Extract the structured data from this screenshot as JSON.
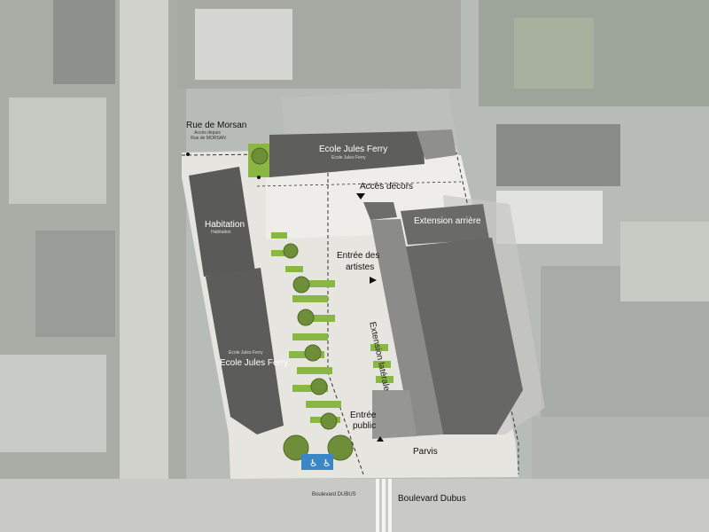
{
  "streets": {
    "rue_morsan": "Rue de Morsan",
    "acces_depuis": "Accès depuis",
    "rue_de_morsan_caps": "Rue de MORSAN",
    "boulevard_dubus_small": "Boulevard DUBUS",
    "boulevard_dubus": "Boulevard Dubus"
  },
  "buildings": {
    "ecole_north": "Ecole Jules Ferry",
    "ecole_north_small": "Ecole Jules Ferry",
    "habitation": "Habitation",
    "habitation_small": "Habitation",
    "ecole_west": "Ecole Jules Ferry",
    "ecole_west_small": "Ecole Jules Ferry",
    "extension_arriere": "Extension arrière",
    "extension_laterale": "Extension latérale"
  },
  "accesses": {
    "acces_decors": "Accès décors",
    "entree_artistes_1": "Entrée des",
    "entree_artistes_2": "artistes",
    "entree_public_1": "Entrée",
    "entree_public_2": "public",
    "parvis": "Parvis"
  },
  "icons": [
    "parking-disabled-icon",
    "access-arrow-icon",
    "tree-icon"
  ],
  "colors": {
    "roof_dark": "#5d5e5c",
    "site_plaza": "#e3e2dd",
    "lawn": "#8ab743",
    "tree": "#6f8e3a",
    "parking_blue": "#3b86c4"
  }
}
